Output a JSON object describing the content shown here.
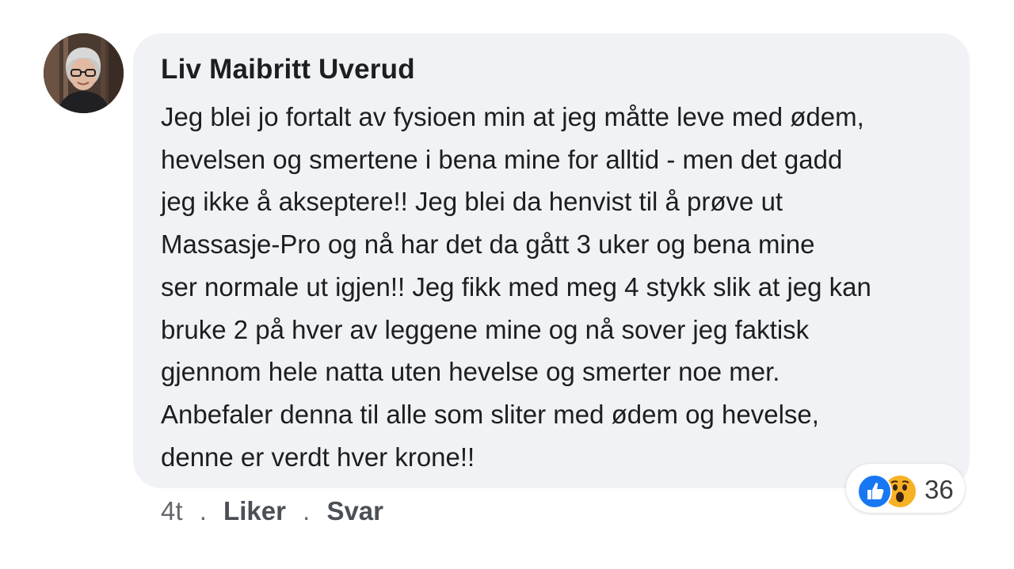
{
  "comment": {
    "author": "Liv Maibritt Uverud",
    "avatar": "avatar",
    "body_lines": [
      "Jeg blei jo fortalt av fysioen min at jeg måtte leve med ødem,",
      "hevelsen og smertene i bena mine for alltid - men det gadd",
      "jeg ikke å akseptere!! Jeg blei da henvist til å prøve ut",
      "Massasje-Pro og nå har det da gått 3 uker og bena mine",
      "ser normale ut igjen!! Jeg fikk med meg 4 stykk slik at jeg kan",
      "bruke 2 på hver av leggene mine og nå sover jeg faktisk",
      "gjennom hele natta uten hevelse og smerter noe mer.",
      "Anbefaler denna til alle som sliter med ødem og hevelse,",
      "denne er verdt hver krone!!"
    ]
  },
  "reactions": {
    "icons": [
      "like-icon",
      "wow-icon"
    ],
    "count": "36"
  },
  "meta": {
    "time": "4t",
    "separator": ".",
    "like_label": "Liker",
    "reply_label": "Svar"
  },
  "colors": {
    "bubble": "#f0f2f5",
    "text": "#1c1e21",
    "meta_text": "#65676b",
    "like_blue": "#1877f2",
    "wow_yellow": "#f7b125"
  }
}
